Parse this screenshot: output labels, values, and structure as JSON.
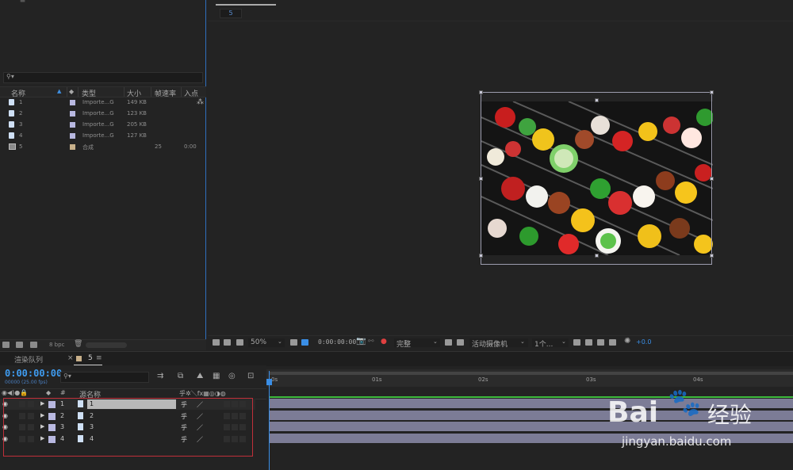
{
  "project": {
    "header": {
      "name": "名称",
      "type": "类型",
      "size": "大小",
      "fps": "帧速率",
      "in": "入点"
    },
    "items": [
      {
        "name": "1",
        "type": "Importe...G",
        "size": "149 KB",
        "fps": "",
        "in": "",
        "label_color": "#b8b8e0",
        "kind": "file"
      },
      {
        "name": "2",
        "type": "Importe...G",
        "size": "123 KB",
        "fps": "",
        "in": "",
        "label_color": "#b8b8e0",
        "kind": "file"
      },
      {
        "name": "3",
        "type": "Importe...G",
        "size": "205 KB",
        "fps": "",
        "in": "",
        "label_color": "#b8b8e0",
        "kind": "file"
      },
      {
        "name": "4",
        "type": "Importe...G",
        "size": "127 KB",
        "fps": "",
        "in": "",
        "label_color": "#b8b8e0",
        "kind": "file"
      },
      {
        "name": "5",
        "type": "合成",
        "size": "",
        "fps": "25",
        "in": "0:00",
        "label_color": "#c8b08a",
        "kind": "comp"
      }
    ],
    "footer": {
      "bpc": "8 bpc"
    }
  },
  "viewer": {
    "comp_label": "5",
    "toolbar": {
      "zoom": "50%",
      "timecode": "0:00:00:00",
      "resolution": "完整",
      "camera": "活动摄像机",
      "views": "1个...",
      "exposure": "+0.0"
    }
  },
  "timeline": {
    "tabs": {
      "render_queue": "渲染队列",
      "comp": "5"
    },
    "timecode": "0:00:00:00",
    "fps_text": "00000 (25.00 fps)",
    "header": {
      "num": "#",
      "source_name": "源名称"
    },
    "layers": [
      {
        "num": "1",
        "name": "1"
      },
      {
        "num": "2",
        "name": "2"
      },
      {
        "num": "3",
        "name": "3"
      },
      {
        "num": "4",
        "name": "4"
      }
    ],
    "ruler": [
      "0s",
      "01s",
      "02s",
      "03s",
      "04s"
    ]
  },
  "watermark": {
    "brand": "Bai",
    "brand2": "经验",
    "url": "jingyan.baidu.com"
  },
  "colors": {
    "accent": "#3a8ee6",
    "layer_label": "#b8b8e0",
    "selection": "#c0303a",
    "bar": "#7c7c96"
  }
}
